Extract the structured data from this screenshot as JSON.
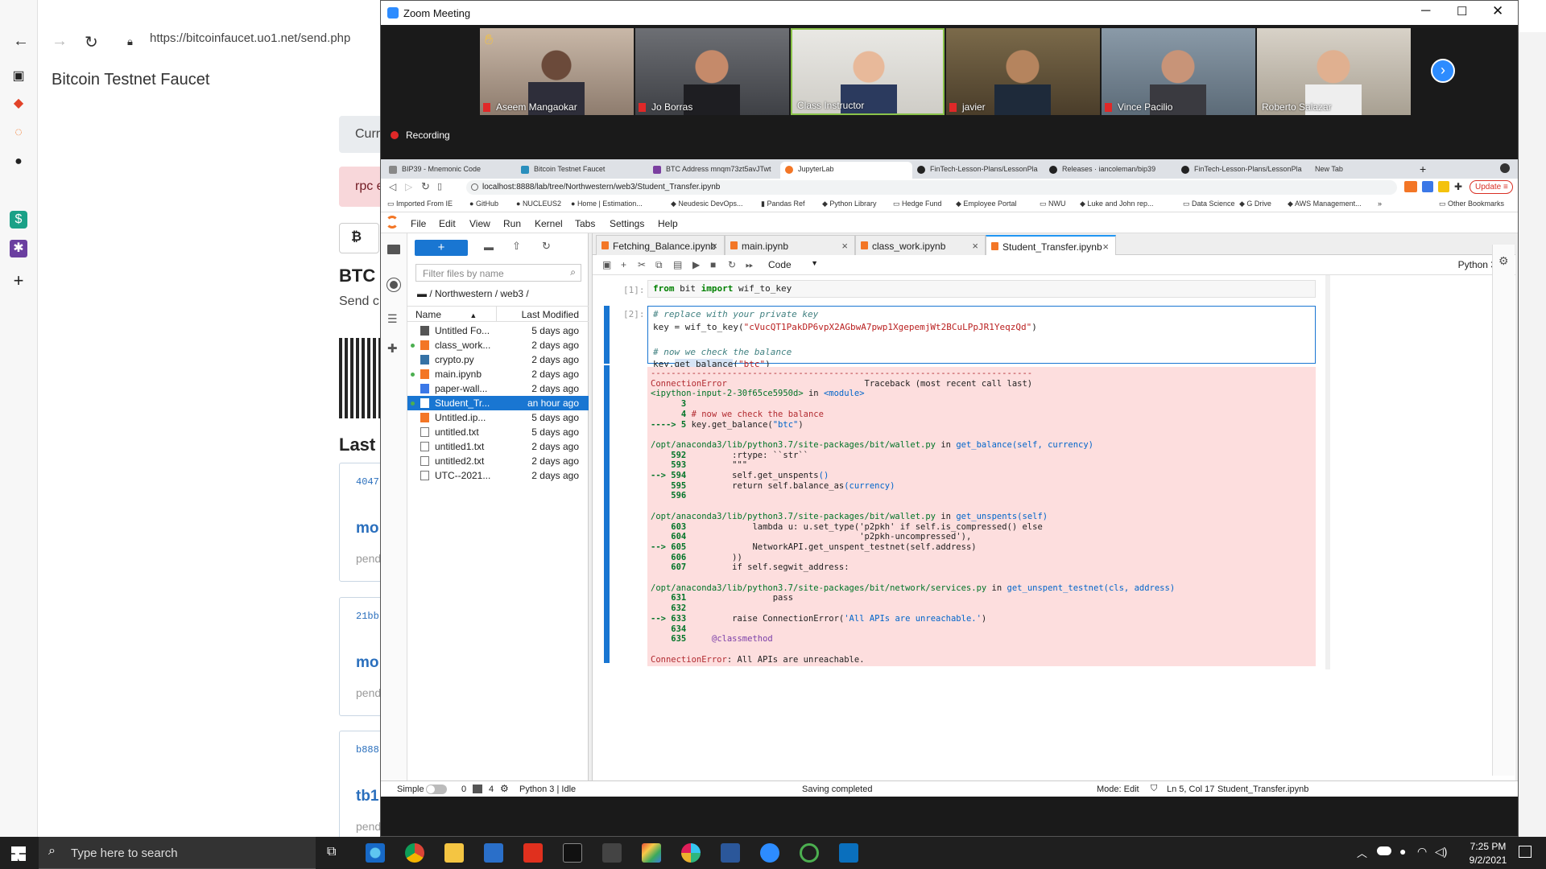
{
  "edge": {
    "url": "https://bitcoinfaucet.uo1.net/send.php",
    "page_title": "Bitcoin Testnet Faucet",
    "partial_texts": [
      "Curr",
      "rpc e",
      "BTC",
      "Send c",
      "Last T"
    ],
    "tx_hashes": [
      "4047",
      "21bb",
      "b888"
    ],
    "tx_labels": [
      "mo",
      "mo",
      "tb1"
    ],
    "tx_status": [
      "pend",
      "pend",
      "pend"
    ]
  },
  "zoom": {
    "title": "Zoom Meeting",
    "recording_label": "Recording",
    "participants": [
      {
        "name": "Aseem Mangaokar",
        "muted": true,
        "hand": true
      },
      {
        "name": "Jo Borras",
        "muted": true
      },
      {
        "name": "Class Instructor",
        "muted": false,
        "active": true
      },
      {
        "name": "javier",
        "muted": true
      },
      {
        "name": "Vince Pacilio",
        "muted": true
      },
      {
        "name": "Roberto Salazar",
        "muted": false
      }
    ]
  },
  "chrome": {
    "tabs": [
      {
        "label": "BIP39 - Mnemonic Code",
        "color": "#888888"
      },
      {
        "label": "Bitcoin Testnet Faucet",
        "color": "#2a8fbd"
      },
      {
        "label": "BTC Address mnqm73zt5avJTwt",
        "color": "#7b3fa0"
      },
      {
        "label": "JupyterLab",
        "color": "#f37626"
      },
      {
        "label": "FinTech-Lesson-Plans/LessonPla",
        "color": "#222222"
      },
      {
        "label": "Releases · iancoleman/bip39",
        "color": "#222222"
      },
      {
        "label": "FinTech-Lesson-Plans/LessonPla",
        "color": "#222222"
      },
      {
        "label": "New Tab",
        "color": "#dee1e6"
      }
    ],
    "url": "localhost:8888/lab/tree/Northwestern/web3/Student_Transfer.ipynb",
    "update_label": "Update",
    "bookmarks": [
      "Imported From IE",
      "GitHub",
      "NUCLEUS2",
      "Home | Estimation...",
      "Neudesic DevOps...",
      "Pandas Ref",
      "Python Library",
      "Hedge Fund",
      "Employee Portal",
      "NWU",
      "Luke and John rep...",
      "Data Science",
      "G Drive",
      "AWS Management..."
    ],
    "other_bookmarks": "Other Bookmarks"
  },
  "jupyter": {
    "menu": [
      "File",
      "Edit",
      "View",
      "Run",
      "Kernel",
      "Tabs",
      "Settings",
      "Help"
    ],
    "filter_placeholder": "Filter files by name",
    "breadcrumb": "/ Northwestern / web3 /",
    "col_name": "Name",
    "col_modified": "Last Modified",
    "files": [
      {
        "name": "Untitled Fo...",
        "modified": "5 days ago",
        "type": "folder",
        "running": false
      },
      {
        "name": "class_work...",
        "modified": "2 days ago",
        "type": "notebook",
        "running": true
      },
      {
        "name": "crypto.py",
        "modified": "2 days ago",
        "type": "python",
        "running": false
      },
      {
        "name": "main.ipynb",
        "modified": "2 days ago",
        "type": "notebook",
        "running": true
      },
      {
        "name": "paper-wall...",
        "modified": "2 days ago",
        "type": "web",
        "running": false
      },
      {
        "name": "Student_Tr...",
        "modified": "an hour ago",
        "type": "notebook",
        "running": true,
        "selected": true
      },
      {
        "name": "Untitled.ip...",
        "modified": "5 days ago",
        "type": "notebook",
        "running": false
      },
      {
        "name": "untitled.txt",
        "modified": "5 days ago",
        "type": "text",
        "running": false
      },
      {
        "name": "untitled1.txt",
        "modified": "2 days ago",
        "type": "text",
        "running": false
      },
      {
        "name": "untitled2.txt",
        "modified": "2 days ago",
        "type": "text",
        "running": false
      },
      {
        "name": "UTC--2021...",
        "modified": "2 days ago",
        "type": "text",
        "running": false
      }
    ],
    "doc_tabs": [
      "Fetching_Balance.ipynb",
      "main.ipynb",
      "class_work.ipynb",
      "Student_Transfer.ipynb"
    ],
    "active_tab": "Student_Transfer.ipynb",
    "cell_type": "Code",
    "kernel_name": "Python 3",
    "cell1_prompt": "[1]:",
    "cell2_prompt": "[2]:",
    "status": {
      "simple": "Simple",
      "terminals": "0",
      "kernels": "4",
      "kernel_state": "Python 3 | Idle",
      "message": "Saving completed",
      "mode": "Mode: Edit",
      "position": "Ln 5, Col 17",
      "filename": "Student_Transfer.ipynb"
    }
  },
  "taskbar": {
    "search_placeholder": "Type here to search",
    "time": "7:25 PM",
    "date": "9/2/2021"
  }
}
